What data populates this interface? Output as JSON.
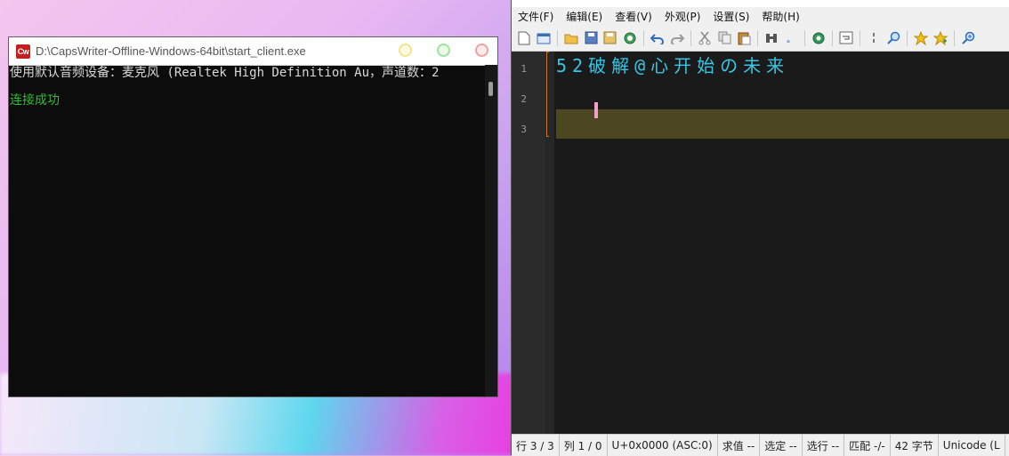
{
  "console": {
    "title": "D:\\CapsWriter-Offline-Windows-64bit\\start_client.exe",
    "app_icon_label": "Cw",
    "lines": [
      "使用默认音频设备：麦克风 (Realtek High Definition Au，声道数：2",
      "连接成功"
    ],
    "success_color": "#2fbf2f"
  },
  "editor": {
    "menu": [
      "文件(F)",
      "编辑(E)",
      "查看(V)",
      "外观(P)",
      "设置(S)",
      "帮助(H)"
    ],
    "line_numbers": [
      "1",
      "2",
      "3"
    ],
    "lines": [
      "52破解@心开始の未来",
      "",
      ""
    ],
    "current_line_color": "#4d4721",
    "text_color": "#33c7e6",
    "status": {
      "line": "行 3 / 3",
      "col": "列 1 / 0",
      "char": "U+0x0000 (ASC:0)",
      "sum": "求值 --",
      "sel": "选定 --",
      "sel_lines": "选行 --",
      "match": "匹配 -/-",
      "bytes": "42 字节",
      "encoding": "Unicode (L"
    }
  }
}
